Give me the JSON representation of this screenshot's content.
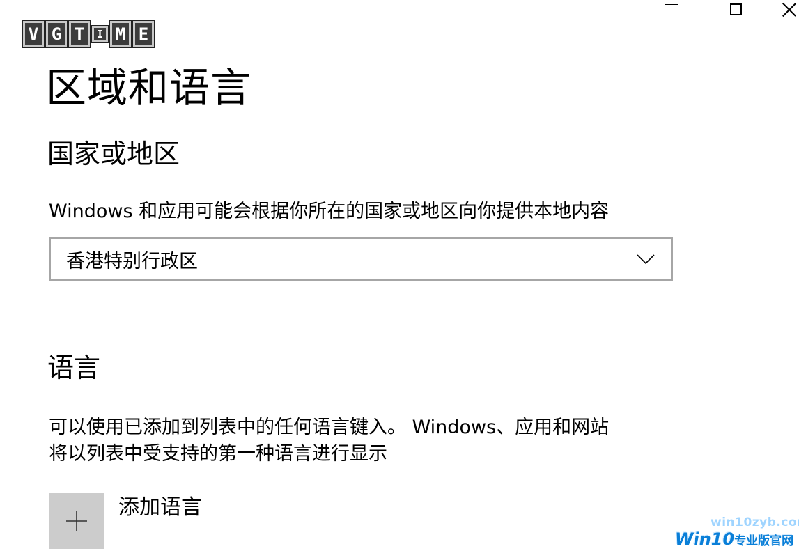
{
  "window": {
    "minimize_icon": "minimize-icon",
    "maximize_icon": "maximize-icon",
    "close_icon": "close-icon"
  },
  "logo": {
    "letters": [
      "v",
      "g",
      "t",
      "i",
      "m",
      "e"
    ]
  },
  "page": {
    "title": "区域和语言"
  },
  "region": {
    "heading": "国家或地区",
    "description": "Windows 和应用可能会根据你所在的国家或地区向你提供本地内容",
    "selected": "香港特别行政区",
    "chevron_icon": "chevron-down-icon"
  },
  "language": {
    "heading": "语言",
    "description_line1": "可以使用已添加到列表中的任何语言键入。 Windows、应用和网站",
    "description_line2": "将以列表中受支持的第一种语言进行显示",
    "add_label": "添加语言",
    "add_icon": "plus-icon"
  },
  "watermark": {
    "url": "win10zyb.com",
    "brand": "Win10",
    "brand_suffix": "专业版官网"
  },
  "colors": {
    "background": "#ffffff",
    "text": "#000000",
    "dropdown_border": "#a6a6a6",
    "add_tile": "#cccccc",
    "watermark_blue": "#0a7fd8"
  }
}
